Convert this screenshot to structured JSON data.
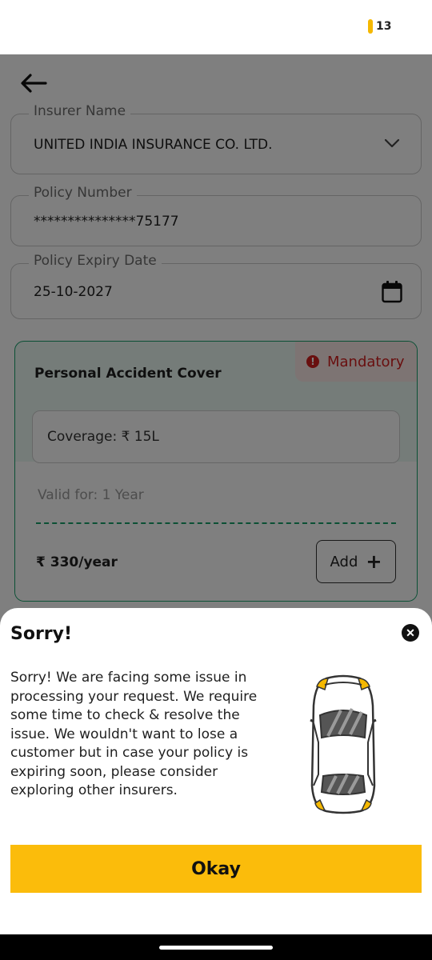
{
  "status_bar": {
    "battery_level": "13"
  },
  "form": {
    "insurer": {
      "label": "Insurer Name",
      "value": "UNITED INDIA INSURANCE CO. LTD."
    },
    "policy_number": {
      "label": "Policy Number",
      "value": "***************75177"
    },
    "expiry": {
      "label": "Policy Expiry Date",
      "value": "25-10-2027"
    }
  },
  "cover_card": {
    "title": "Personal Accident Cover",
    "badge": "Mandatory",
    "coverage": "Coverage: ₹ 15L",
    "validity": "Valid for: 1 Year",
    "price": "₹ 330/year",
    "add_label": "Add",
    "add_symbol": "+"
  },
  "dialog": {
    "title": "Sorry!",
    "message": "Sorry! We are facing some issue in processing your request. We require some time to check & resolve the issue. We wouldn't want to lose a customer but in case your policy is expiring soon, please consider exploring other insurers.",
    "ok_label": "Okay",
    "close_symbol": "✕"
  },
  "colors": {
    "accent_yellow": "#fbbc0b",
    "card_green": "#17a06b",
    "mandatory_red": "#d21f1f"
  },
  "icons": [
    "back-arrow-icon",
    "chevron-down-icon",
    "calendar-icon",
    "alert-icon",
    "plus-icon",
    "close-icon",
    "car-icon"
  ]
}
